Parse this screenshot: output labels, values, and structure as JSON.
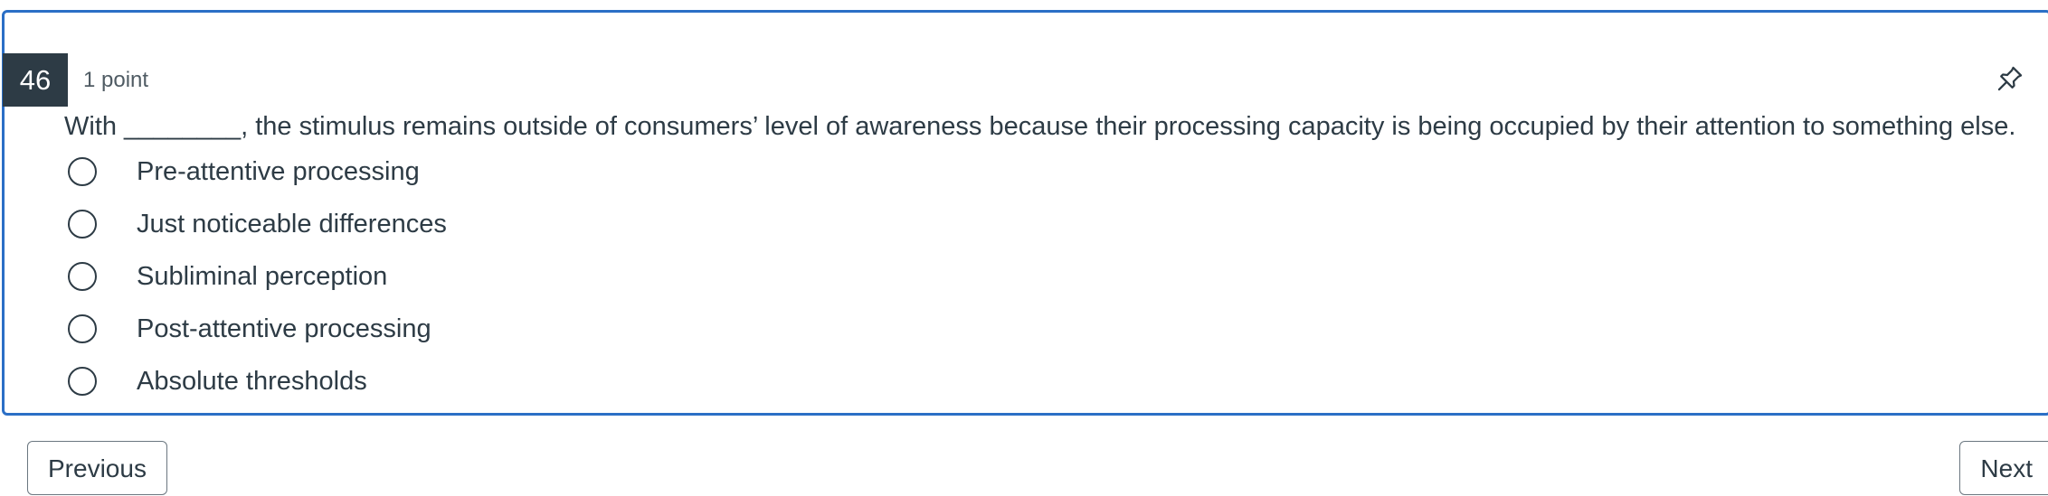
{
  "question": {
    "number": "46",
    "points": "1 point",
    "text": "With ________, the stimulus remains outside of consumers’ level of awareness because their processing capacity is being occupied by their attention to something else.",
    "pin_icon": "pin-icon"
  },
  "answers": [
    {
      "label": "Pre-attentive processing",
      "selected": false
    },
    {
      "label": "Just noticeable differences",
      "selected": false
    },
    {
      "label": "Subliminal perception",
      "selected": false
    },
    {
      "label": "Post-attentive processing",
      "selected": false
    },
    {
      "label": "Absolute thresholds",
      "selected": false
    }
  ],
  "navigation": {
    "previous_label": "Previous",
    "next_label": "Next"
  },
  "colors": {
    "card_border": "#2b6fc6",
    "number_badge": "#2d3b45",
    "text": "#2d3b45"
  }
}
